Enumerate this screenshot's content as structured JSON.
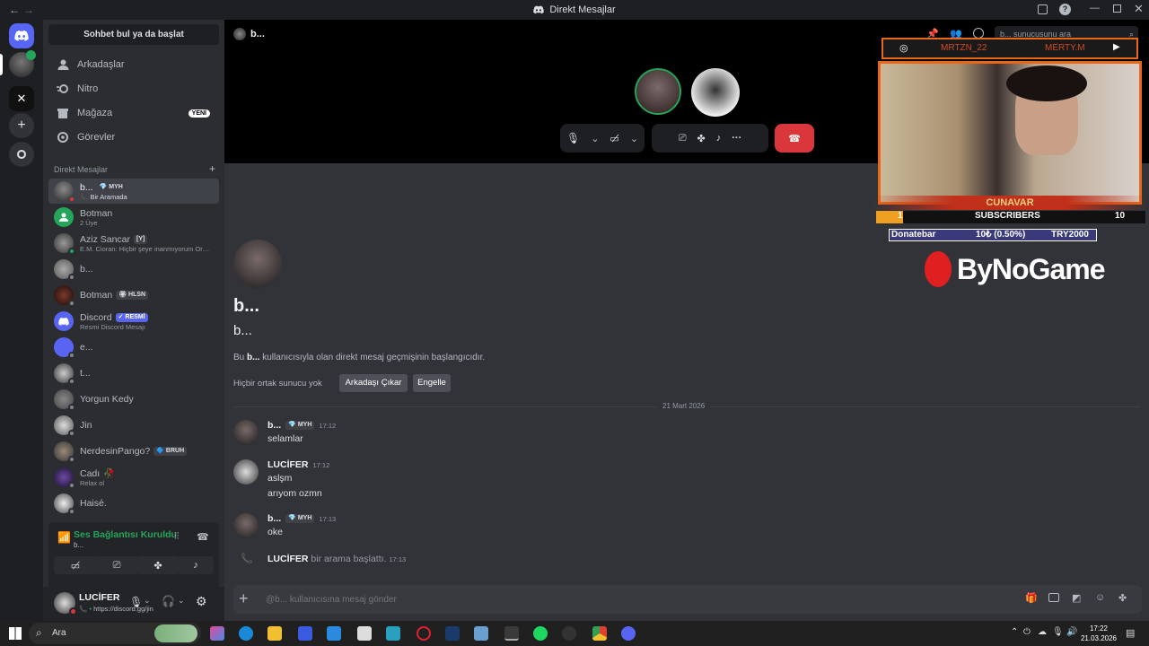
{
  "window": {
    "title": "Direkt Mesajlar"
  },
  "sidebar": {
    "search_button": "Sohbet bul ya da başlat",
    "nav": [
      {
        "label": "Arkadaşlar",
        "icon": "friends-icon"
      },
      {
        "label": "Nitro",
        "icon": "nitro-icon"
      },
      {
        "label": "Mağaza",
        "icon": "shop-icon",
        "badge": "YENİ"
      },
      {
        "label": "Görevler",
        "icon": "quests-icon"
      }
    ],
    "dm_header": "Direkt Mesajlar",
    "dms": [
      {
        "name": "b...",
        "tag": "MYH",
        "sub": "Bir Aramada",
        "active": true
      },
      {
        "name": "Botman",
        "sub": "2 Üye"
      },
      {
        "name": "Aziz Sancar",
        "tag": "[Y]",
        "sub": "E.M. Cioran: Hiçbir şeye inanmıyorum Orma..."
      },
      {
        "name": "b...",
        "sub": ""
      },
      {
        "name": "Botman",
        "tag": "HLSN",
        "sub": ""
      },
      {
        "name": "Discord",
        "tag": "✓ RESMİ",
        "sub": "Resmi Discord Mesajı"
      },
      {
        "name": "e...",
        "sub": ""
      },
      {
        "name": "t...",
        "sub": ""
      },
      {
        "name": "Yorgun Kedy",
        "sub": ""
      },
      {
        "name": "Jin",
        "sub": ""
      },
      {
        "name": "NerdesinPango?",
        "tag": "BRUH",
        "sub": ""
      },
      {
        "name": "Cadı",
        "sub": "Relax ol"
      },
      {
        "name": "Haisé.",
        "sub": ""
      }
    ],
    "voice": {
      "status": "Ses Bağlantısı Kuruldu",
      "channel": "b..."
    },
    "user": {
      "name": "LUCİFER",
      "status": "https://discord.gg/jin"
    }
  },
  "header": {
    "name": "b...",
    "search_placeholder": "b... sunucusunu ara"
  },
  "intro": {
    "title": "b...",
    "subtitle": "b...",
    "text_prefix": "Bu ",
    "text_name": "b...",
    "text_suffix": " kullanıcısıyla olan direkt mesaj geçmişinin başlangıcıdır.",
    "no_servers": "Hiçbir ortak sunucu yok",
    "remove_friend": "Arkadaşı Çıkar",
    "block": "Engelle"
  },
  "date_divider": "21 Mart 2026",
  "messages": [
    {
      "author": "b...",
      "tag": "MYH",
      "time": "17:12",
      "lines": [
        "selamlar"
      ]
    },
    {
      "author": "LUCİFER",
      "time": "17:12",
      "lines": [
        "aslşm",
        "arıyom ozmn"
      ]
    },
    {
      "author": "b...",
      "tag": "MYH",
      "time": "17:13",
      "lines": [
        "oke"
      ]
    }
  ],
  "call_event": {
    "author": "LUCİFER",
    "text": "bir arama başlattı.",
    "time": "17:13"
  },
  "composer": {
    "placeholder": "@b... kullanıcısına mesaj gönder"
  },
  "overlay": {
    "left_handle": "MRTZN_22",
    "right_handle": "MERTY.M",
    "name": "CUNAVAR",
    "subs_left": "1",
    "subs_label": "SUBSCRIBERS",
    "subs_right": "10",
    "donate_label": "Donatebar",
    "donate_amount": "10₺ (0.50%)",
    "donate_goal": "TRY2000",
    "brand": "ByNoGame"
  },
  "taskbar": {
    "search": "Ara",
    "time": "17:22",
    "date": "21.03.2026"
  },
  "colors": {
    "blurple": "#5865f2",
    "green": "#23a55a",
    "red": "#da373c",
    "orange": "#f0a020"
  }
}
